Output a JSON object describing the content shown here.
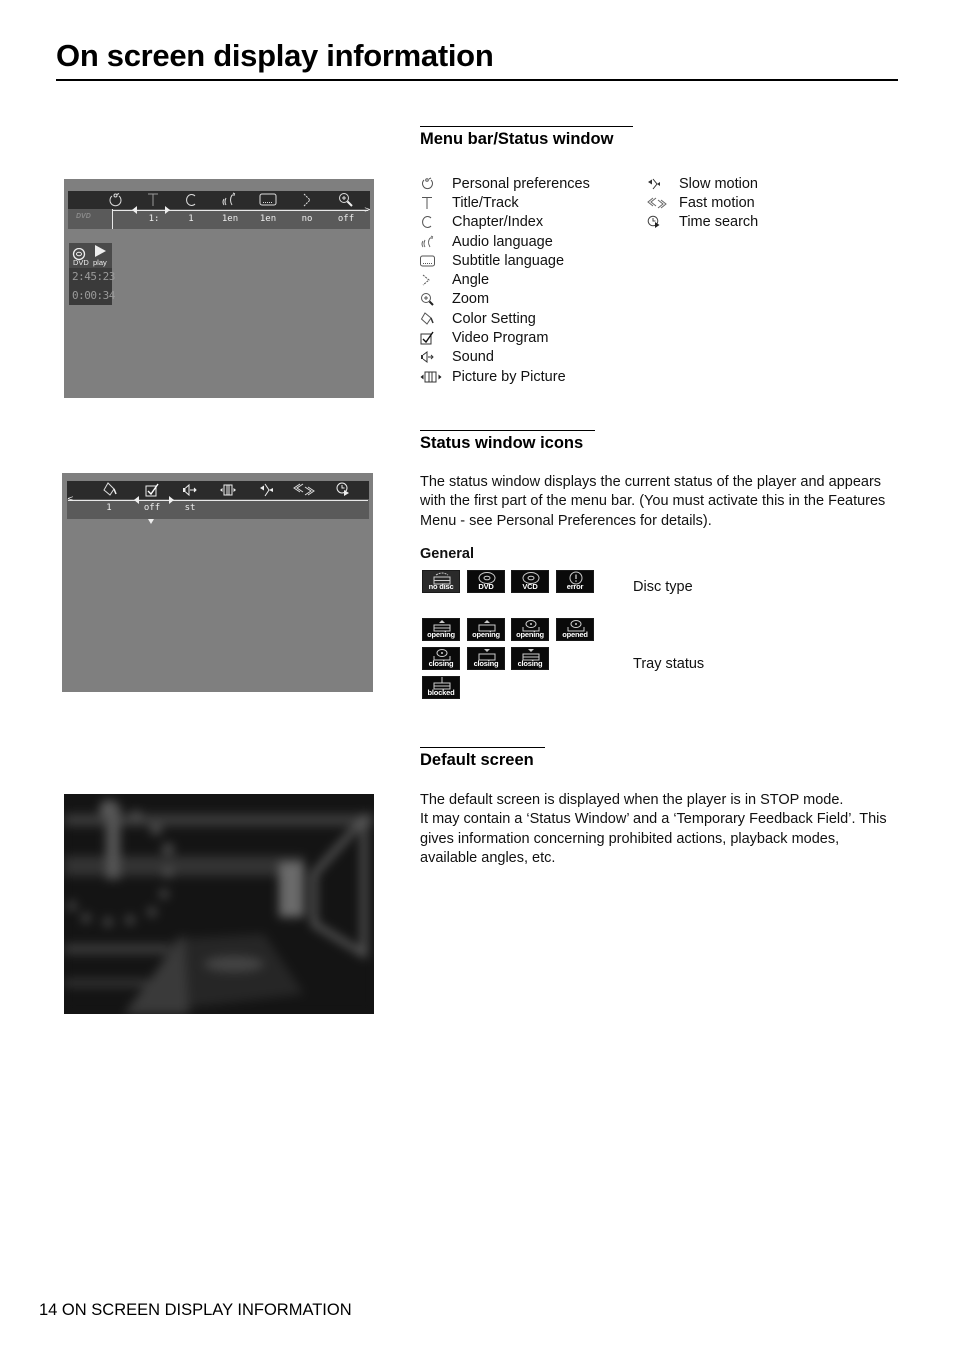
{
  "page": {
    "title": "On screen display information",
    "footer": "14 ON SCREEN DISPLAY INFORMATION"
  },
  "menu_bar_section": {
    "heading": "Menu bar/Status window",
    "legend_left": [
      {
        "icon": "personal-preferences-icon",
        "label": "Personal preferences"
      },
      {
        "icon": "title-track-icon",
        "label": "Title/Track"
      },
      {
        "icon": "chapter-index-icon",
        "label": "Chapter/Index"
      },
      {
        "icon": "audio-language-icon",
        "label": "Audio language"
      },
      {
        "icon": "subtitle-language-icon",
        "label": "Subtitle language"
      },
      {
        "icon": "angle-icon",
        "label": "Angle"
      },
      {
        "icon": "zoom-icon",
        "label": "Zoom"
      },
      {
        "icon": "color-setting-icon",
        "label": "Color Setting"
      },
      {
        "icon": "video-program-icon",
        "label": "Video Program"
      },
      {
        "icon": "sound-icon",
        "label": "Sound"
      },
      {
        "icon": "picture-by-picture-icon",
        "label": "Picture by Picture"
      }
    ],
    "legend_right": [
      {
        "icon": "slow-motion-icon",
        "label": "Slow motion"
      },
      {
        "icon": "fast-motion-icon",
        "label": "Fast motion"
      },
      {
        "icon": "time-search-icon",
        "label": "Time search"
      }
    ]
  },
  "osd_screen_1": {
    "disc_logo": "DVD",
    "menu_values": [
      "1:",
      "1",
      "1en",
      "1en",
      "no",
      "off"
    ],
    "status_window": {
      "disc_label": "DVD",
      "play_label": "play",
      "total_time": "2:45:23",
      "elapsed_time": "0:00:34"
    }
  },
  "osd_screen_2": {
    "menu_values": [
      "1",
      "off",
      "st",
      "",
      "",
      "",
      ""
    ]
  },
  "status_icons_section": {
    "heading": "Status window icons",
    "description": "The status window displays the current status of the player and appears with the first part of the menu bar. (You must activate this in the Features Menu - see Personal Preferences for details).",
    "general_label": "General",
    "disc_type_caption": "Disc type",
    "tray_status_caption": "Tray status",
    "disc_type_icons": [
      "no disc",
      "DVD",
      "VCD",
      "error"
    ],
    "tray_icons_row1": [
      "opening",
      "opening",
      "opening",
      "opened"
    ],
    "tray_icons_row2": [
      "closing",
      "closing",
      "closing"
    ],
    "tray_icons_row3": [
      "blocked"
    ]
  },
  "default_screen_section": {
    "heading": "Default screen",
    "line1": "The default screen is displayed when the player is in STOP mode.",
    "line2": "It may contain a ‘Status Window’ and a ‘Temporary Feedback Field’. This gives information concerning prohibited actions, playback modes, available angles, etc."
  }
}
